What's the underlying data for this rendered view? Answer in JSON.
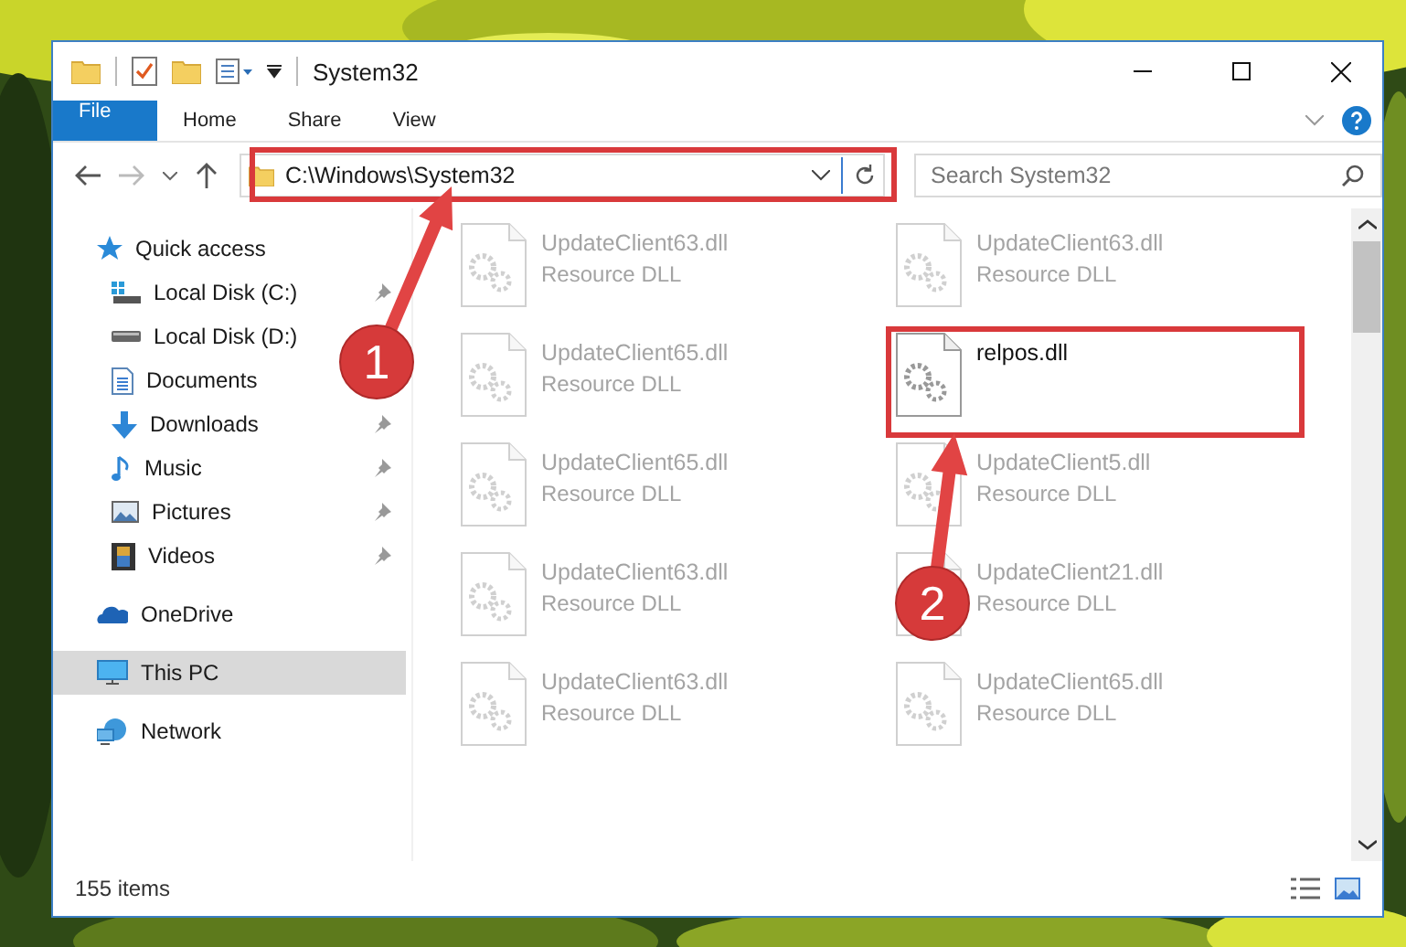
{
  "window": {
    "title": "System32"
  },
  "ribbon": {
    "tabs": [
      {
        "label": "File",
        "kind": "file"
      },
      {
        "label": "Home",
        "kind": "tab"
      },
      {
        "label": "Share",
        "kind": "tab"
      },
      {
        "label": "View",
        "kind": "tab"
      }
    ]
  },
  "address_bar": {
    "path": "C:\\Windows\\System32"
  },
  "search": {
    "placeholder": "Search System32"
  },
  "navigation": [
    {
      "label": "Quick access",
      "kind": "star",
      "selected": false,
      "children": [
        {
          "label": "Local Disk (C:)",
          "kind": "drive-windows",
          "pinned": true,
          "selected": false
        },
        {
          "label": "Local Disk (D:)",
          "kind": "drive",
          "selected": false
        },
        {
          "label": "Documents",
          "kind": "documents",
          "selected": false
        },
        {
          "label": "Downloads",
          "kind": "downloads",
          "pinned": true,
          "selected": false
        },
        {
          "label": "Music",
          "kind": "music",
          "pinned": true,
          "selected": false
        },
        {
          "label": "Pictures",
          "kind": "pictures",
          "pinned": true,
          "selected": false
        },
        {
          "label": "Videos",
          "kind": "videos",
          "pinned": true,
          "selected": false
        }
      ]
    },
    {
      "label": "OneDrive",
      "kind": "cloud",
      "selected": false
    },
    {
      "label": "This PC",
      "kind": "pc",
      "selected": true
    },
    {
      "label": "Network",
      "kind": "network",
      "selected": false
    }
  ],
  "files": [
    {
      "name": "UpdateClient63.dll",
      "type": "Resource DLL",
      "blurred": true
    },
    {
      "name": "UpdateClient63.dll",
      "type": "Resource DLL",
      "blurred": true
    },
    {
      "name": "UpdateClient65.dll",
      "type": "Resource DLL",
      "blurred": true
    },
    {
      "name": "relpos.dll",
      "blurred": false
    },
    {
      "name": "UpdateClient65.dll",
      "type": "Resource DLL",
      "blurred": true
    },
    {
      "name": "UpdateClient5.dll",
      "type": "Resource DLL",
      "blurred": true
    },
    {
      "name": "UpdateClient63.dll",
      "type": "Resource DLL",
      "blurred": true
    },
    {
      "name": "UpdateClient21.dll",
      "type": "Resource DLL",
      "blurred": true
    },
    {
      "name": "UpdateClient63.dll",
      "type": "Resource DLL",
      "blurred": true
    },
    {
      "name": "UpdateClient65.dll",
      "type": "Resource DLL",
      "blurred": true
    }
  ],
  "status_bar": {
    "count": "155 items"
  },
  "callouts": [
    {
      "number": "1"
    },
    {
      "number": "2"
    }
  ]
}
